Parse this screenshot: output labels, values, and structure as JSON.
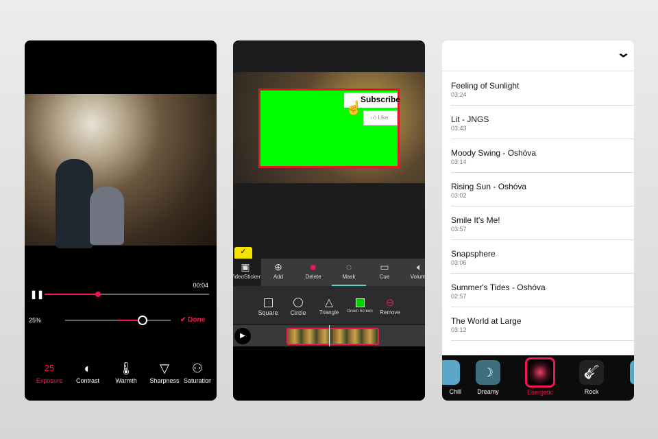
{
  "editor": {
    "time": "00:04",
    "progress": 0.33,
    "intensity_label": "25%",
    "intensity": 0.75,
    "done_label": "Done",
    "tools": [
      {
        "label": "Exposure",
        "value": "25",
        "icon": "exposure-value"
      },
      {
        "label": "Contrast",
        "icon": "contrast-icon"
      },
      {
        "label": "Warmth",
        "icon": "thermometer-icon"
      },
      {
        "label": "Sharpness",
        "icon": "triangle-icon"
      },
      {
        "label": "Saturation",
        "icon": "circles-icon"
      }
    ]
  },
  "video": {
    "sticker_text": "Subscribe",
    "like_text": "Like",
    "toolbar": [
      {
        "label": "VideoSticker"
      },
      {
        "label": "Add"
      },
      {
        "label": "Delete"
      },
      {
        "label": "Mask"
      },
      {
        "label": "Cue"
      },
      {
        "label": "Volume"
      }
    ],
    "shapes": [
      {
        "label": "Square"
      },
      {
        "label": "Circle"
      },
      {
        "label": "Triangle"
      },
      {
        "label": "Green Screen"
      },
      {
        "label": "Remove"
      }
    ],
    "accent": "#f0164f",
    "green": "#00ff00"
  },
  "music": {
    "songs": [
      {
        "title": "Feeling of Sunlight",
        "duration": "03:24"
      },
      {
        "title": "Lit - JNGS",
        "duration": "03:43"
      },
      {
        "title": "Moody Swing - Oshóva",
        "duration": "03:14"
      },
      {
        "title": "Rising Sun - Oshóva",
        "duration": "03:02"
      },
      {
        "title": "Smile It's Me!",
        "duration": "03:57"
      },
      {
        "title": "Snapsphere",
        "duration": "03:06"
      },
      {
        "title": "Summer's Tides - Oshóva",
        "duration": "02:57"
      },
      {
        "title": "The World at Large",
        "duration": "03:12"
      }
    ],
    "genres": [
      {
        "label": "Chill"
      },
      {
        "label": "Dreamy"
      },
      {
        "label": "Energetic",
        "selected": true
      },
      {
        "label": "Rock"
      }
    ]
  }
}
